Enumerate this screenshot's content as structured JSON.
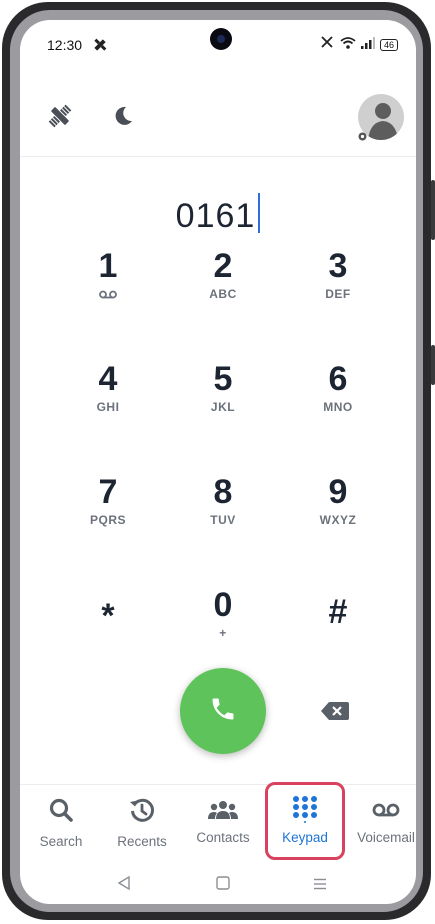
{
  "status_bar": {
    "time": "12:30",
    "battery": "46"
  },
  "dialer": {
    "number": "0161"
  },
  "keys": [
    {
      "digit": "1",
      "letters": ""
    },
    {
      "digit": "2",
      "letters": "ABC"
    },
    {
      "digit": "3",
      "letters": "DEF"
    },
    {
      "digit": "4",
      "letters": "GHI"
    },
    {
      "digit": "5",
      "letters": "JKL"
    },
    {
      "digit": "6",
      "letters": "MNO"
    },
    {
      "digit": "7",
      "letters": "PQRS"
    },
    {
      "digit": "8",
      "letters": "TUV"
    },
    {
      "digit": "9",
      "letters": "WXYZ"
    },
    {
      "digit": "*",
      "letters": ""
    },
    {
      "digit": "0",
      "letters": "+"
    },
    {
      "digit": "#",
      "letters": ""
    }
  ],
  "nav": [
    {
      "label": "Search",
      "icon": "search-icon"
    },
    {
      "label": "Recents",
      "icon": "history-icon"
    },
    {
      "label": "Contacts",
      "icon": "people-icon"
    },
    {
      "label": "Keypad",
      "icon": "dialpad-icon",
      "active": true
    },
    {
      "label": "Voicemail",
      "icon": "voicemail-icon"
    }
  ],
  "colors": {
    "call": "#5fc35b",
    "accent": "#1e74d9",
    "highlight": "#d8425e",
    "text": "#1d2533"
  }
}
